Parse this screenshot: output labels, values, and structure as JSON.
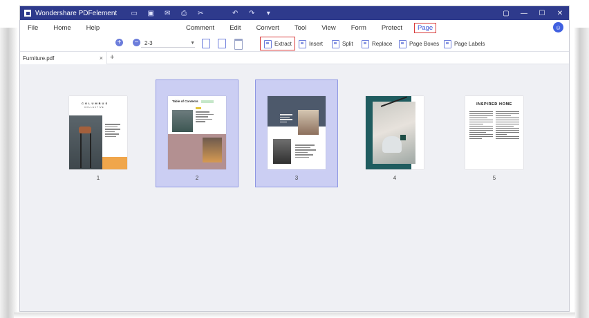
{
  "app": {
    "title": "Wondershare PDFelement",
    "window_controls": [
      "restore-icon",
      "minimize-icon",
      "maximize-icon",
      "close-icon"
    ]
  },
  "menu": {
    "left": [
      "File",
      "Home",
      "Help"
    ],
    "tabs": [
      "Comment",
      "Edit",
      "Convert",
      "Tool",
      "View",
      "Form",
      "Protect",
      "Page"
    ],
    "active_tab": "Page"
  },
  "toolbar": {
    "page_range": "2-3",
    "extract": "Extract",
    "insert": "Insert",
    "split": "Split",
    "replace": "Replace",
    "page_boxes": "Page Boxes",
    "page_labels": "Page Labels"
  },
  "file_tab": {
    "name": "Furniture.pdf",
    "close": "×",
    "add": "+"
  },
  "pages": [
    {
      "number": "1",
      "selected": false
    },
    {
      "number": "2",
      "selected": true
    },
    {
      "number": "3",
      "selected": true
    },
    {
      "number": "4",
      "selected": false
    },
    {
      "number": "5",
      "selected": false
    }
  ],
  "thumb_text": {
    "p1_title": "COLUMBUS",
    "p1_sub": "COLLECTIVE",
    "p2_title": "Table of Contents",
    "p5_title": "INSPIRED HOME"
  },
  "colors": {
    "titlebar": "#2e3a8c",
    "accent": "#3b51d6",
    "highlight_box": "#d83a3a",
    "selection_fill": "#cbcef3"
  }
}
